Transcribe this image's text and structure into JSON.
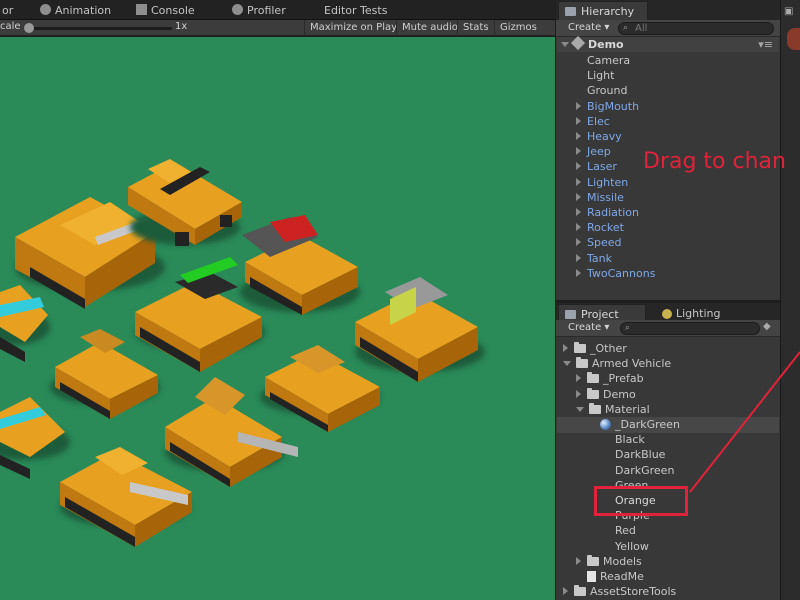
{
  "top_tabs": [
    "or",
    "Animation",
    "Console",
    "Profiler",
    "Editor Tests"
  ],
  "game_toolbar": {
    "scale_label": "cale",
    "scale_value": "1x",
    "buttons": [
      "Maximize on Play",
      "Mute audio",
      "Stats",
      "Gizmos"
    ]
  },
  "hierarchy": {
    "tab_label": "Hierarchy",
    "create_label": "Create",
    "search_placeholder": "All",
    "scene_name": "Demo",
    "children": [
      {
        "label": "Camera",
        "expandable": false
      },
      {
        "label": "Light",
        "expandable": false
      },
      {
        "label": "Ground",
        "expandable": false
      },
      {
        "label": "BigMouth",
        "expandable": true
      },
      {
        "label": "Elec",
        "expandable": true
      },
      {
        "label": "Heavy",
        "expandable": true
      },
      {
        "label": "Jeep",
        "expandable": true
      },
      {
        "label": "Laser",
        "expandable": true
      },
      {
        "label": "Lighten",
        "expandable": true
      },
      {
        "label": "Missile",
        "expandable": true
      },
      {
        "label": "Radiation",
        "expandable": true
      },
      {
        "label": "Rocket",
        "expandable": true
      },
      {
        "label": "Speed",
        "expandable": true
      },
      {
        "label": "Tank",
        "expandable": true
      },
      {
        "label": "TwoCannons",
        "expandable": true
      }
    ]
  },
  "project": {
    "tab_label": "Project",
    "lighting_tab_label": "Lighting",
    "create_label": "Create",
    "items": [
      {
        "label": "_Other",
        "type": "folder",
        "state": "collapsed"
      },
      {
        "label": "Armed Vehicle",
        "type": "folder",
        "state": "expanded"
      },
      {
        "label": "_Prefab",
        "type": "folder",
        "state": "collapsed"
      },
      {
        "label": "Demo",
        "type": "folder",
        "state": "collapsed"
      },
      {
        "label": "Material",
        "type": "folder",
        "state": "expanded"
      },
      {
        "label": "_DarkGreen",
        "type": "material",
        "state": "selected"
      },
      {
        "label": "Black",
        "type": "material",
        "state": "none"
      },
      {
        "label": "DarkBlue",
        "type": "material",
        "state": "none"
      },
      {
        "label": "DarkGreen",
        "type": "material",
        "state": "none"
      },
      {
        "label": "Green",
        "type": "material",
        "state": "none"
      },
      {
        "label": "Orange",
        "type": "material",
        "state": "highlighted"
      },
      {
        "label": "Purple",
        "type": "material",
        "state": "none"
      },
      {
        "label": "Red",
        "type": "material",
        "state": "none"
      },
      {
        "label": "Yellow",
        "type": "material",
        "state": "none"
      },
      {
        "label": "Models",
        "type": "folder",
        "state": "collapsed"
      },
      {
        "label": "ReadMe",
        "type": "document",
        "state": "none"
      },
      {
        "label": "AssetStoreTools",
        "type": "folder",
        "state": "collapsed"
      }
    ]
  },
  "annotation": {
    "text": "Drag to chan",
    "color": "#e0223a"
  },
  "colors": {
    "game_background": "#2a8a58",
    "vehicle_orange": "#e8a020",
    "hierarchy_prefab_text": "#7fa8e8"
  },
  "icons": [
    "unity-logo-icon",
    "search-icon",
    "folder-icon",
    "material-sphere-icon",
    "document-icon",
    "lock-icon",
    "menu-icon"
  ]
}
